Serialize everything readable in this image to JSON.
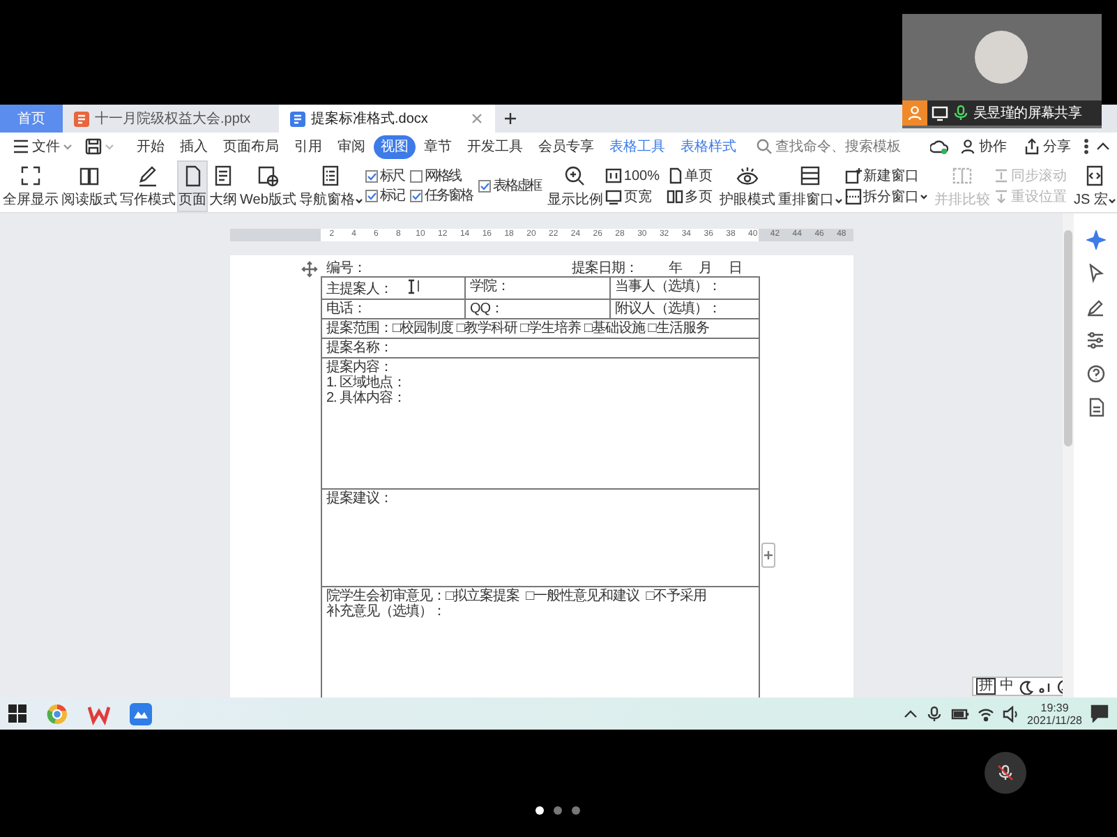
{
  "screen_share": {
    "presenter": "吴昱瑾的屏幕共享"
  },
  "tabs": [
    {
      "label": "首页",
      "kind": "home",
      "selected": false
    },
    {
      "label": "十一月院级权益大会.pptx",
      "kind": "pptx",
      "selected": false
    },
    {
      "label": "提案标准格式.docx",
      "kind": "docx",
      "selected": true
    }
  ],
  "menu": {
    "file": "文件",
    "tabs": [
      {
        "label": "开始",
        "kind": "main",
        "selected": false
      },
      {
        "label": "插入",
        "kind": "main",
        "selected": false
      },
      {
        "label": "页面布局",
        "kind": "main",
        "selected": false
      },
      {
        "label": "引用",
        "kind": "main",
        "selected": false
      },
      {
        "label": "审阅",
        "kind": "main",
        "selected": false
      },
      {
        "label": "视图",
        "kind": "main",
        "selected": true
      },
      {
        "label": "章节",
        "kind": "main",
        "selected": false
      },
      {
        "label": "开发工具",
        "kind": "main",
        "selected": false
      },
      {
        "label": "会员专享",
        "kind": "main",
        "selected": false
      },
      {
        "label": "表格工具",
        "kind": "context",
        "selected": false
      },
      {
        "label": "表格样式",
        "kind": "context",
        "selected": false
      }
    ],
    "search": {
      "placeholder": "查找命令、搜索模板"
    },
    "actions": [
      "协作",
      "分享"
    ]
  },
  "ribbon": [
    {
      "kind": "big",
      "label": "全屏显示",
      "selected": false,
      "disabled": false
    },
    {
      "kind": "big",
      "label": "阅读版式",
      "selected": false,
      "disabled": false
    },
    {
      "kind": "big",
      "label": "写作模式",
      "selected": false,
      "disabled": false
    },
    {
      "kind": "big",
      "label": "页面",
      "selected": true,
      "disabled": false
    },
    {
      "kind": "big",
      "label": "大纲",
      "selected": false,
      "disabled": false
    },
    {
      "kind": "big",
      "label": "Web版式",
      "selected": false,
      "disabled": false
    },
    {
      "kind": "big",
      "label": "导航窗格",
      "selected": false,
      "disabled": false,
      "dropdown": true
    },
    {
      "kind": "checks",
      "items": [
        {
          "label": "标尺",
          "checked": true
        },
        {
          "label": "标记",
          "checked": true
        }
      ]
    },
    {
      "kind": "checks",
      "items": [
        {
          "label": "网格线",
          "checked": false
        },
        {
          "label": "任务窗格",
          "checked": true
        }
      ]
    },
    {
      "kind": "checks",
      "items": [
        {
          "label": "表格虚框",
          "checked": true
        }
      ]
    },
    {
      "kind": "big",
      "label": "显示比例",
      "selected": false,
      "disabled": false
    },
    {
      "kind": "small",
      "items": [
        {
          "label": "100%",
          "disabled": false
        },
        {
          "label": "页宽",
          "disabled": false
        }
      ]
    },
    {
      "kind": "small",
      "items": [
        {
          "label": "单页",
          "disabled": false
        },
        {
          "label": "多页",
          "disabled": false
        }
      ]
    },
    {
      "kind": "big",
      "label": "护眼模式",
      "selected": false,
      "disabled": false
    },
    {
      "kind": "big",
      "label": "重排窗口",
      "selected": false,
      "disabled": false,
      "dropdown": true
    },
    {
      "kind": "small",
      "items": [
        {
          "label": "新建窗口",
          "disabled": false
        },
        {
          "label": "拆分窗口",
          "disabled": false,
          "dropdown": true
        }
      ]
    },
    {
      "kind": "big",
      "label": "并排比较",
      "selected": false,
      "disabled": true
    },
    {
      "kind": "small",
      "items": [
        {
          "label": "同步滚动",
          "disabled": true
        },
        {
          "label": "重设位置",
          "disabled": true
        }
      ]
    },
    {
      "kind": "big",
      "label": "JS 宏",
      "selected": false,
      "disabled": false,
      "dropdown": true
    }
  ],
  "ruler": [
    "2",
    "4",
    "6",
    "8",
    "10",
    "12",
    "14",
    "16",
    "18",
    "20",
    "22",
    "24",
    "26",
    "28",
    "30",
    "32",
    "34",
    "36",
    "38",
    "40",
    "42",
    "44",
    "46",
    "48"
  ],
  "document": {
    "number_label": "编号：",
    "date_label": "提案日期：",
    "date_parts": [
      "年",
      "月",
      "日"
    ],
    "rows": [
      {
        "kind": "fields",
        "cells": [
          "主提案人：",
          "学院：",
          "当事人（选填）："
        ]
      },
      {
        "kind": "fields",
        "cells": [
          "电话：",
          "QQ：",
          "附议人（选填）："
        ]
      },
      {
        "kind": "line",
        "lines": [
          "提案范围：□校园制度 □教学科研 □学生培养 □基础设施 □生活服务"
        ]
      },
      {
        "kind": "line",
        "lines": [
          "提案名称："
        ]
      },
      {
        "kind": "area",
        "lines": [
          "提案内容：",
          "1. 区域地点：",
          "2. 具体内容："
        ]
      },
      {
        "kind": "area",
        "lines": [
          "提案建议："
        ]
      },
      {
        "kind": "area",
        "lines": [
          "院学生会初审意见：□拟立案提案  □一般性意见和建议  □不予采用",
          "补充意见（选填）："
        ]
      }
    ]
  },
  "ime": [
    "拼",
    "中"
  ],
  "taskbar": {
    "time": "19:39",
    "date": "2021/11/28"
  },
  "call": {
    "muted": true
  },
  "pager": [
    {
      "selected": true
    },
    {
      "selected": false
    },
    {
      "selected": false
    }
  ]
}
